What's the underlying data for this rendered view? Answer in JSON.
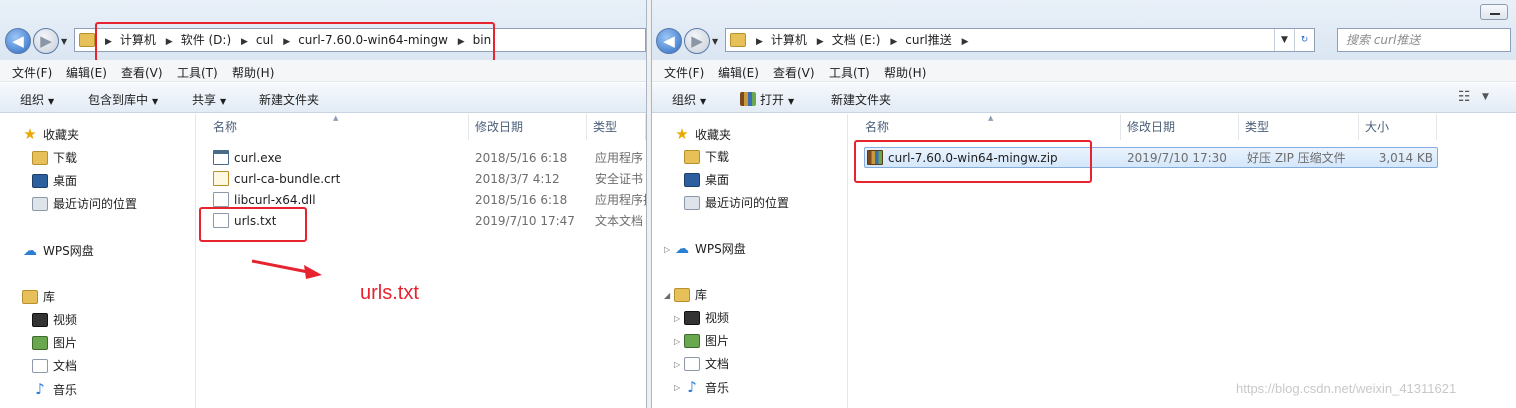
{
  "left": {
    "breadcrumbs": [
      "计算机",
      "软件 (D:)",
      "cul",
      "curl-7.60.0-win64-mingw",
      "bin"
    ],
    "menu": [
      "文件(F)",
      "编辑(E)",
      "查看(V)",
      "工具(T)",
      "帮助(H)"
    ],
    "toolbar": {
      "organize": "组织",
      "include": "包含到库中",
      "share": "共享",
      "new_folder": "新建文件夹"
    },
    "nav": {
      "favorites": "收藏夹",
      "downloads": "下载",
      "desktop": "桌面",
      "recent": "最近访问的位置",
      "wps": "WPS网盘",
      "library": "库",
      "video": "视频",
      "pictures": "图片",
      "docs": "文档",
      "music": "音乐"
    },
    "columns": {
      "name": "名称",
      "date": "修改日期",
      "type": "类型"
    },
    "files": [
      {
        "name": "curl.exe",
        "date": "2018/5/16 6:18",
        "type": "应用程序",
        "icon": "exe-icon"
      },
      {
        "name": "curl-ca-bundle.crt",
        "date": "2018/3/7 4:12",
        "type": "安全证书",
        "icon": "certificate-icon"
      },
      {
        "name": "libcurl-x64.dll",
        "date": "2018/5/16 6:18",
        "type": "应用程序扩",
        "icon": "dll-icon"
      },
      {
        "name": "urls.txt",
        "date": "2019/7/10 17:47",
        "type": "文本文档",
        "icon": "text-file-icon"
      }
    ]
  },
  "right": {
    "breadcrumbs": [
      "计算机",
      "文档 (E:)",
      "curl推送"
    ],
    "search_placeholder": "搜索 curl推送",
    "menu": [
      "文件(F)",
      "编辑(E)",
      "查看(V)",
      "工具(T)",
      "帮助(H)"
    ],
    "toolbar": {
      "organize": "组织",
      "open": "打开",
      "new_folder": "新建文件夹"
    },
    "nav": {
      "favorites": "收藏夹",
      "downloads": "下载",
      "desktop": "桌面",
      "recent": "最近访问的位置",
      "wps": "WPS网盘",
      "library": "库",
      "video": "视频",
      "pictures": "图片",
      "docs": "文档",
      "music": "音乐"
    },
    "columns": {
      "name": "名称",
      "date": "修改日期",
      "type": "类型",
      "size": "大小"
    },
    "files": [
      {
        "name": "curl-7.60.0-win64-mingw.zip",
        "date": "2019/7/10 17:30",
        "type": "好压 ZIP 压缩文件",
        "size": "3,014 KB",
        "icon": "zip-archive-icon"
      }
    ]
  },
  "annotation": {
    "label": "urls.txt",
    "color": "#e6232f"
  },
  "watermark": "https://blog.csdn.net/weixin_41311621"
}
